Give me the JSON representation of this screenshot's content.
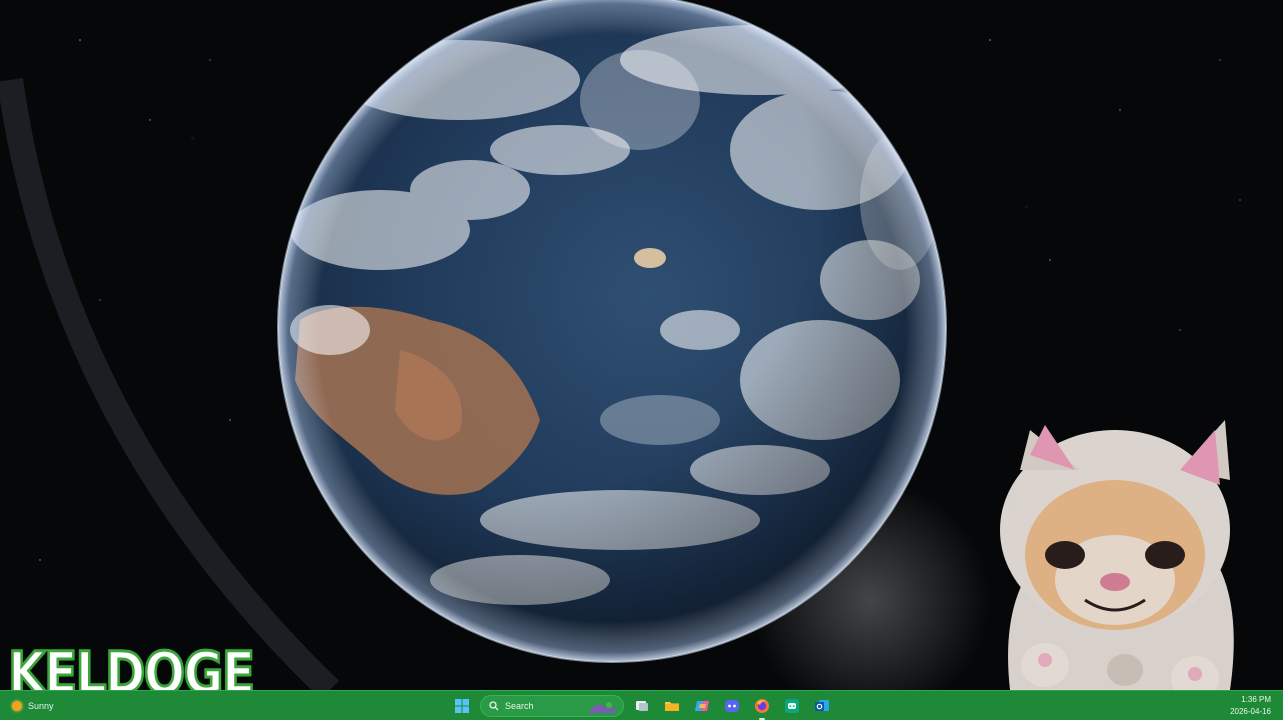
{
  "wallpaper": {
    "description_icon": "earth-from-space-wallpaper",
    "mascot_icon": "cat-astronaut-mascot"
  },
  "watermark": {
    "text": "KELDOGE",
    "color": "#3aa63a"
  },
  "taskbar": {
    "color": "#1e8a37",
    "weather": {
      "label": "Sunny",
      "icon": "sun-icon"
    },
    "search": {
      "placeholder": "Search"
    },
    "icons": [
      "windows-start-icon",
      "search-icon",
      "task-view-icon",
      "file-explorer-icon",
      "copilot-icon",
      "discord-icon",
      "firefox-icon",
      "chatgpt-icon",
      "outlook-icon"
    ],
    "clock": {
      "time": "1:36 PM",
      "date": "2026-04-16"
    }
  }
}
